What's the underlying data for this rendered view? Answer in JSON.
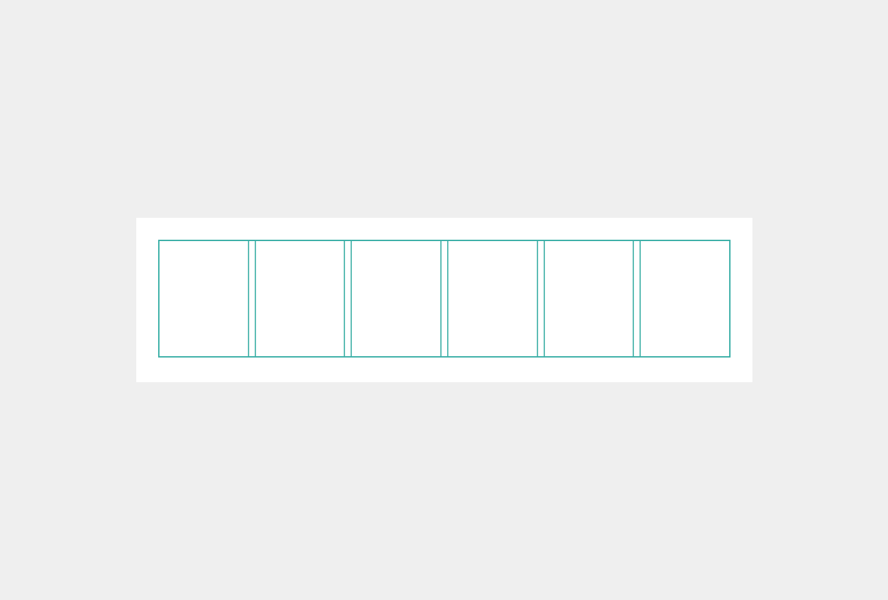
{
  "layout_preview": {
    "column_count": 6,
    "colors": {
      "background": "#efefef",
      "card": "#ffffff",
      "grid_border": "#3db0a8",
      "gutter_border": "#5cbcb4"
    }
  }
}
